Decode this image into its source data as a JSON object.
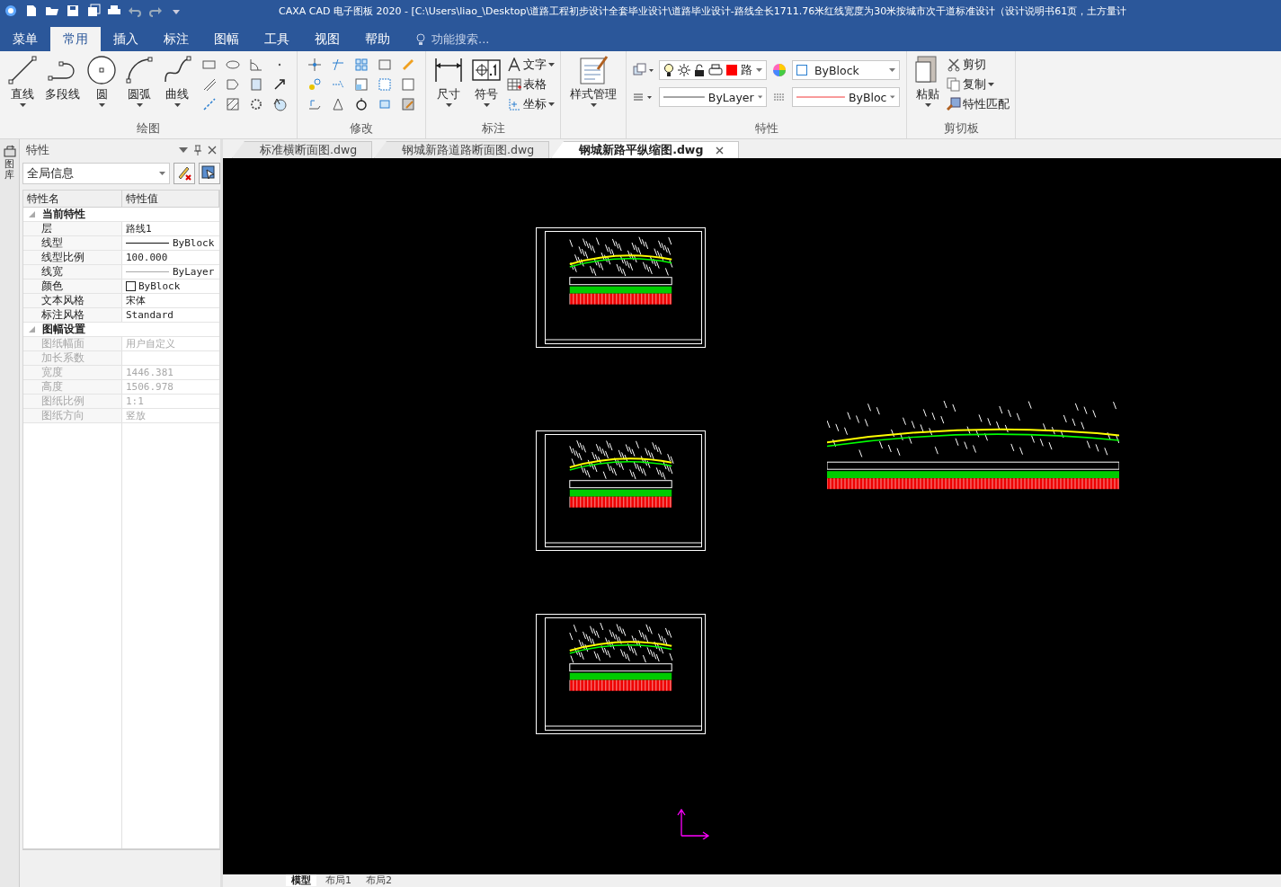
{
  "window": {
    "title": "CAXA CAD 电子图板 2020 - [C:\\Users\\liao_\\Desktop\\道路工程初步设计全套毕业设计\\道路毕业设计-路线全长1711.76米红线宽度为30米按城市次干道标准设计（设计说明书61页，土方量计"
  },
  "menu_tabs": [
    {
      "label": "菜单",
      "selected": false
    },
    {
      "label": "常用",
      "selected": true
    },
    {
      "label": "插入",
      "selected": false
    },
    {
      "label": "标注",
      "selected": false
    },
    {
      "label": "图幅",
      "selected": false
    },
    {
      "label": "工具",
      "selected": false
    },
    {
      "label": "视图",
      "selected": false
    },
    {
      "label": "帮助",
      "selected": false
    }
  ],
  "search": {
    "placeholder": "功能搜索..."
  },
  "ribbon": {
    "draw": {
      "label": "绘图",
      "tools": [
        "直线",
        "多段线",
        "圆",
        "圆弧",
        "曲线"
      ]
    },
    "modify": {
      "label": "修改"
    },
    "annotate": {
      "label": "标注",
      "large": [
        "尺寸",
        "符号"
      ],
      "small": [
        "文字",
        "表格",
        "坐标"
      ]
    },
    "style": {
      "label": "样式管理"
    },
    "properties": {
      "label": "特性",
      "layer": "路",
      "color_setting": "ByBlock",
      "linetype": "ByLayer",
      "linewidth": "ByBloc"
    },
    "clipboard": {
      "label": "剪切板",
      "paste": "粘贴",
      "small": [
        "剪切",
        "复制",
        "特性匹配"
      ]
    }
  },
  "side_strip": {
    "label": "图库"
  },
  "properties_panel": {
    "title": "特性",
    "filter": "全局信息",
    "columns": [
      "特性名",
      "特性值"
    ],
    "sections": [
      {
        "label": "当前特性",
        "expanded": true,
        "rows": [
          {
            "name": "层",
            "value": "路线1",
            "kind": "text",
            "disabled": false
          },
          {
            "name": "线型",
            "value": "ByBlock",
            "kind": "line",
            "disabled": false
          },
          {
            "name": "线型比例",
            "value": "100.000",
            "kind": "text",
            "disabled": false
          },
          {
            "name": "线宽",
            "value": "ByLayer",
            "kind": "thin-line",
            "disabled": false
          },
          {
            "name": "颜色",
            "value": "ByBlock",
            "kind": "color",
            "disabled": false
          },
          {
            "name": "文本风格",
            "value": "宋体",
            "kind": "text",
            "disabled": false
          },
          {
            "name": "标注风格",
            "value": "Standard",
            "kind": "text",
            "disabled": false
          }
        ]
      },
      {
        "label": "图幅设置",
        "expanded": true,
        "rows": [
          {
            "name": "图纸幅面",
            "value": "用户自定义",
            "kind": "text",
            "disabled": true
          },
          {
            "name": "加长系数",
            "value": "",
            "kind": "text",
            "disabled": true
          },
          {
            "name": "宽度",
            "value": "1446.381",
            "kind": "text",
            "disabled": true
          },
          {
            "name": "高度",
            "value": "1506.978",
            "kind": "text",
            "disabled": true
          },
          {
            "name": "图纸比例",
            "value": "1:1",
            "kind": "text",
            "disabled": true
          },
          {
            "name": "图纸方向",
            "value": "竖放",
            "kind": "text",
            "disabled": true
          }
        ]
      }
    ]
  },
  "doc_tabs": [
    {
      "label": "标准横断面图.dwg",
      "selected": false
    },
    {
      "label": "钢城新路道路断面图.dwg",
      "selected": false
    },
    {
      "label": "钢城新路平纵缩图.dwg",
      "selected": true
    }
  ],
  "layout_tabs": [
    {
      "label": "模型",
      "selected": true
    },
    {
      "label": "布局1",
      "selected": false
    },
    {
      "label": "布局2",
      "selected": false
    }
  ]
}
